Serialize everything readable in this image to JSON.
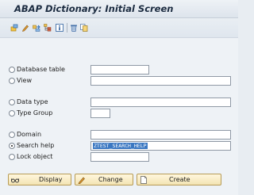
{
  "window": {
    "title": "ABAP Dictionary: Initial Screen"
  },
  "toolbar": {
    "icons": [
      "other-object-icon",
      "edit-icon",
      "where-used-icon",
      "hierarchy-icon",
      "info-icon",
      "delete-icon",
      "copy-icon"
    ]
  },
  "form": {
    "options": [
      {
        "label": "Database table",
        "selected": false,
        "value": ""
      },
      {
        "label": "View",
        "selected": false,
        "value": ""
      },
      {
        "label": "Data type",
        "selected": false,
        "value": ""
      },
      {
        "label": "Type Group",
        "selected": false,
        "value": ""
      },
      {
        "label": "Domain",
        "selected": false,
        "value": ""
      },
      {
        "label": "Search help",
        "selected": true,
        "value": "ZTEST_SEARCH_HELP"
      },
      {
        "label": "Lock object",
        "selected": false,
        "value": ""
      }
    ]
  },
  "buttons": {
    "display": "Display",
    "change": "Change",
    "create": "Create"
  },
  "colors": {
    "background": "#eef2f6",
    "title_text": "#1b2b40",
    "selection": "#3b78c2",
    "button_fill": "#f3e4b3"
  }
}
